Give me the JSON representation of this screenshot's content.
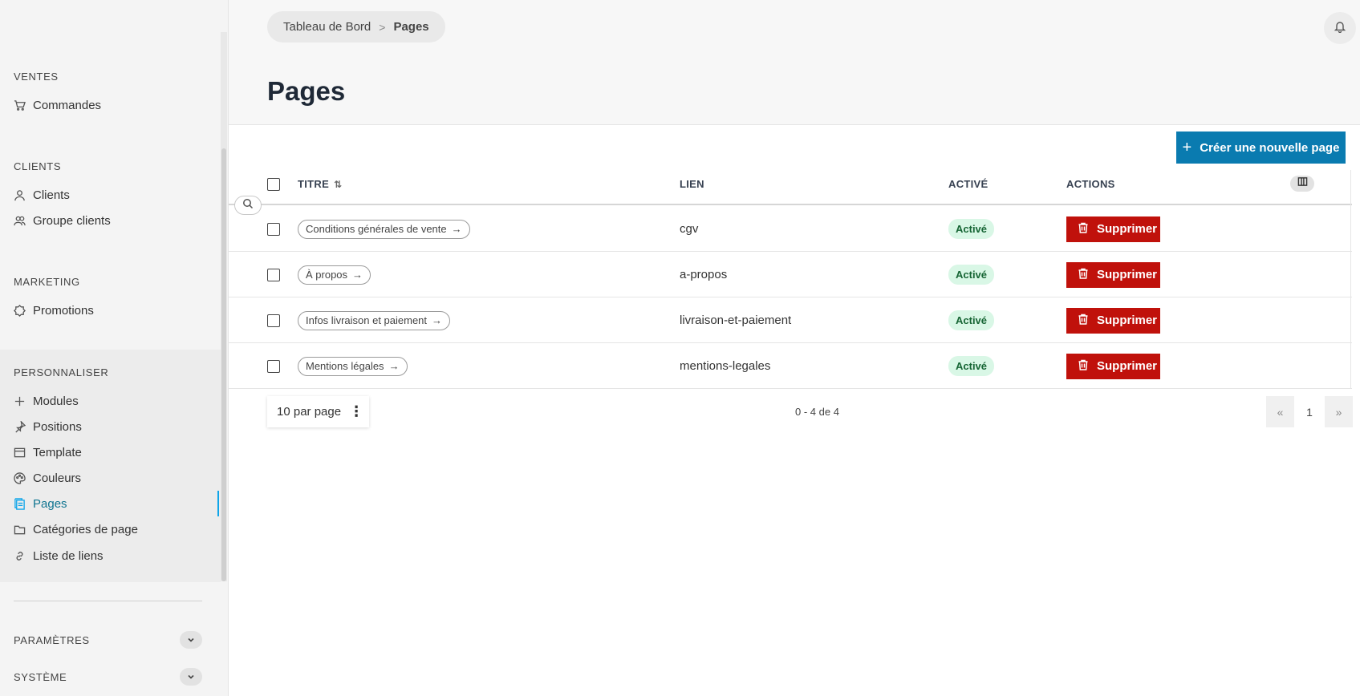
{
  "sidebar": {
    "sections": [
      {
        "title": "VENTES",
        "items": [
          {
            "label": "Commandes",
            "icon": "cart-icon"
          }
        ]
      },
      {
        "title": "CLIENTS",
        "items": [
          {
            "label": "Clients",
            "icon": "user-icon"
          },
          {
            "label": "Groupe clients",
            "icon": "users-icon"
          }
        ]
      },
      {
        "title": "MARKETING",
        "items": [
          {
            "label": "Promotions",
            "icon": "badge-icon"
          }
        ]
      },
      {
        "title": "PERSONNALISER",
        "items": [
          {
            "label": "Modules",
            "icon": "plus-icon"
          },
          {
            "label": "Positions",
            "icon": "pin-icon"
          },
          {
            "label": "Template",
            "icon": "layout-icon"
          },
          {
            "label": "Couleurs",
            "icon": "palette-icon"
          },
          {
            "label": "Pages",
            "icon": "pages-icon",
            "active": true
          },
          {
            "label": "Catégories de page",
            "icon": "folder-icon"
          },
          {
            "label": "Liste de liens",
            "icon": "link-icon"
          }
        ]
      }
    ],
    "collapsibles": [
      {
        "label": "PARAMÈTRES"
      },
      {
        "label": "SYSTÈME"
      }
    ],
    "active_color": "#0ea5e9"
  },
  "breadcrumb": {
    "home": "Tableau de Bord",
    "current": "Pages"
  },
  "page_title": "Pages",
  "create_button": {
    "label": "Créer une nouvelle page",
    "color": "#0a7bb0"
  },
  "table": {
    "columns": {
      "title": "TITRE",
      "link": "LIEN",
      "active": "ACTIVÉ",
      "actions": "ACTIONS"
    },
    "rows": [
      {
        "title": "Conditions générales de vente",
        "link": "cgv",
        "status": "Activé",
        "action": "Supprimer"
      },
      {
        "title": "À propos",
        "link": "a-propos",
        "status": "Activé",
        "action": "Supprimer"
      },
      {
        "title": "Infos livraison et paiement",
        "link": "livraison-et-paiement",
        "status": "Activé",
        "action": "Supprimer"
      },
      {
        "title": "Mentions légales",
        "link": "mentions-legales",
        "status": "Activé",
        "action": "Supprimer"
      }
    ],
    "delete_color": "#c0110b",
    "badge_color": "#d9f7e6"
  },
  "pagination": {
    "per_page": "10 par page",
    "range": "0 - 4 de 4",
    "prev": "«",
    "page": "1",
    "next": "»"
  }
}
